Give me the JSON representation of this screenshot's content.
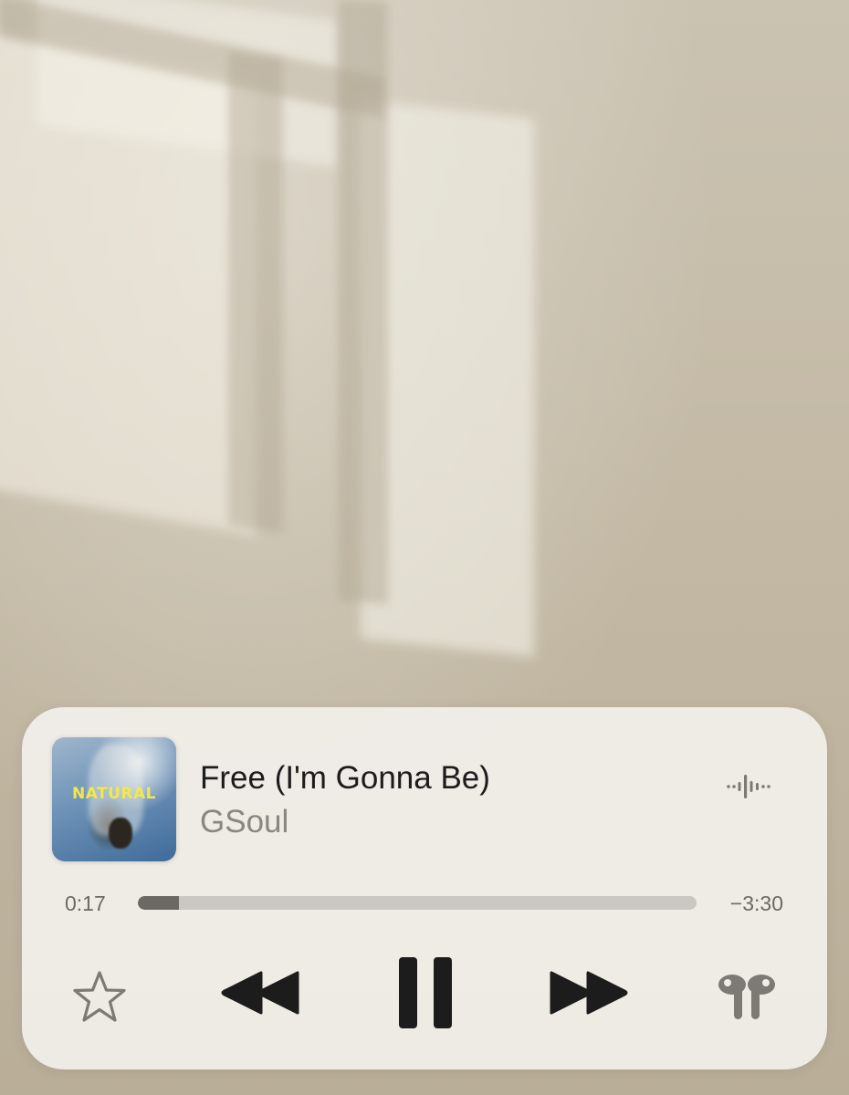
{
  "now_playing": {
    "artwork": {
      "text": "NATURAL",
      "text_color": "#f2e84a"
    },
    "title": "Free (I'm Gonna Be)",
    "artist": "GSoul",
    "waveform_icon": "audio-waveform-icon"
  },
  "playback": {
    "elapsed": "0:17",
    "remaining": "−3:30",
    "progress_fraction": 0.074
  },
  "controls": {
    "favorite_icon": "star-icon",
    "previous_icon": "rewind-icon",
    "play_pause_icon": "pause-icon",
    "next_icon": "fast-forward-icon",
    "output_icon": "airpods-icon"
  },
  "colors": {
    "panel_background": "#f0ede8",
    "title_text": "#1c1c1c",
    "artist_text": "#8a8682",
    "progress_fill": "#6c6864",
    "progress_track": "#cbc7c2",
    "icon_color": "#1c1c1c",
    "icon_muted": "#7d7a76"
  }
}
